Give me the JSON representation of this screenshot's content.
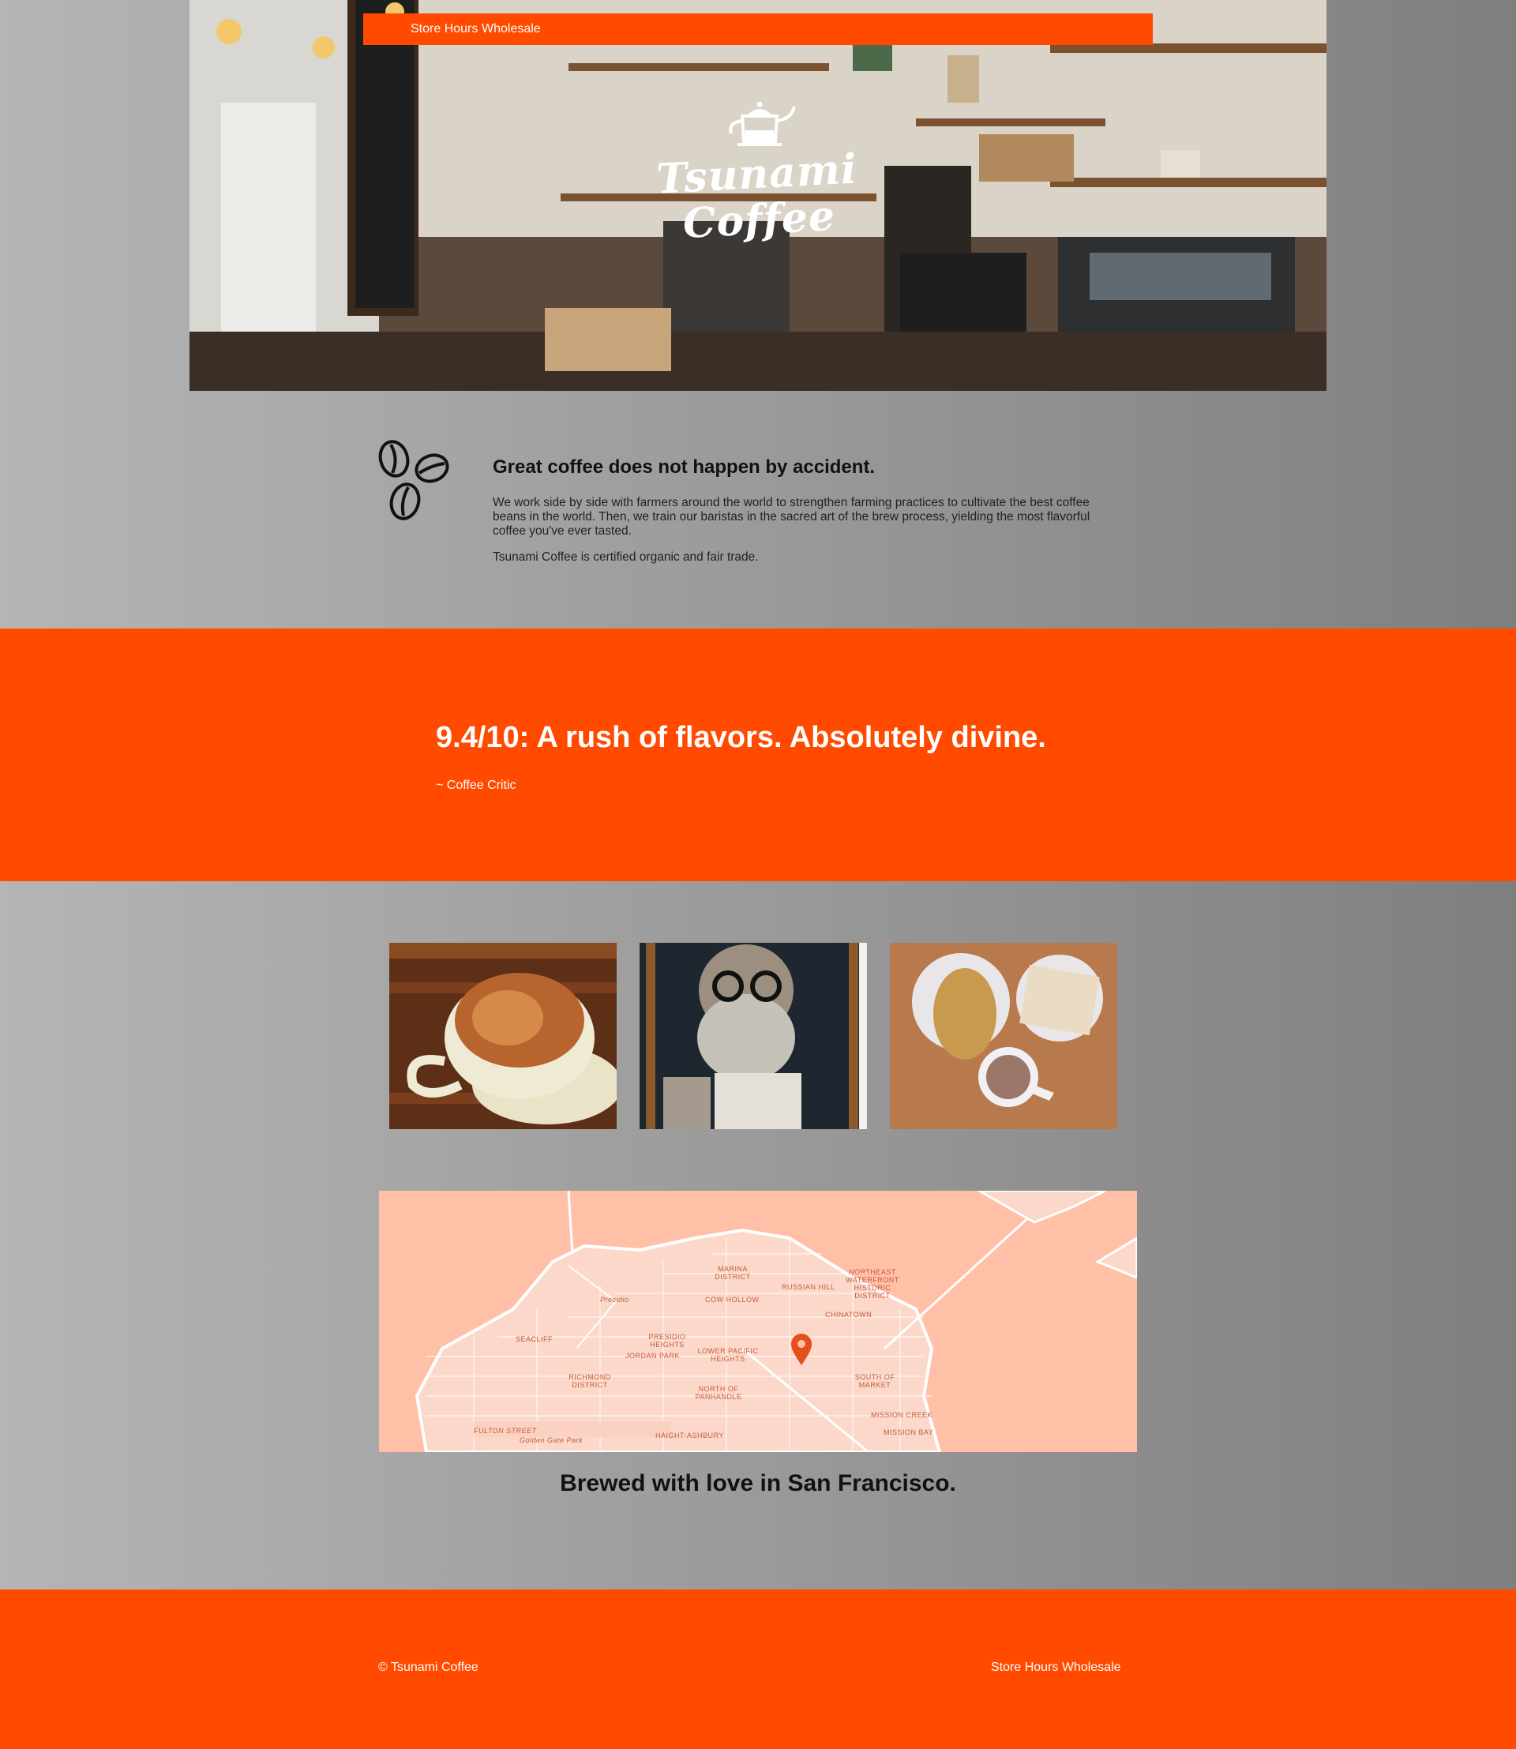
{
  "nav": {
    "items": [
      "Store Hours",
      "Wholesale"
    ]
  },
  "logo": {
    "line1": "Tsunami",
    "line2": "Coffee"
  },
  "intro": {
    "heading": "Great coffee does not happen by accident.",
    "body": "We work side by side with farmers around the world to strengthen farming practices to cultivate the best coffee beans in the world. Then, we train our baristas in the sacred art of the brew process, yielding the most flavorful coffee you've ever tasted.",
    "certification": "Tsunami Coffee is certified organic and fair trade."
  },
  "quote": {
    "text": "9.4/10: A rush of flavors. Absolutely divine.",
    "author": "~ Coffee Critic"
  },
  "map": {
    "labels": [
      "MARINA DISTRICT",
      "NORTHEAST WATERFRONT HISTORIC DISTRICT",
      "RUSSIAN HILL",
      "Presidio",
      "COW HOLLOW",
      "CHINATOWN",
      "SEACLIFF",
      "PRESIDIO HEIGHTS",
      "LOWER PACIFIC HEIGHTS",
      "JORDAN PARK",
      "RICHMOND DISTRICT",
      "NORTH OF PANHANDLE",
      "SOUTH OF MARKET",
      "MISSION CREEK",
      "MISSION BAY",
      "HAIGHT-ASHBURY",
      "FULTON STREET",
      "Golden Gate Park"
    ],
    "pin_color": "#e2501c"
  },
  "map_caption": "Brewed with love in San Francisco.",
  "footer": {
    "copyright": "© Tsunami Coffee",
    "links": [
      "Store Hours",
      "Wholesale"
    ]
  },
  "colors": {
    "accent": "#ff4a00",
    "map_bg": "#ffc0a7"
  }
}
